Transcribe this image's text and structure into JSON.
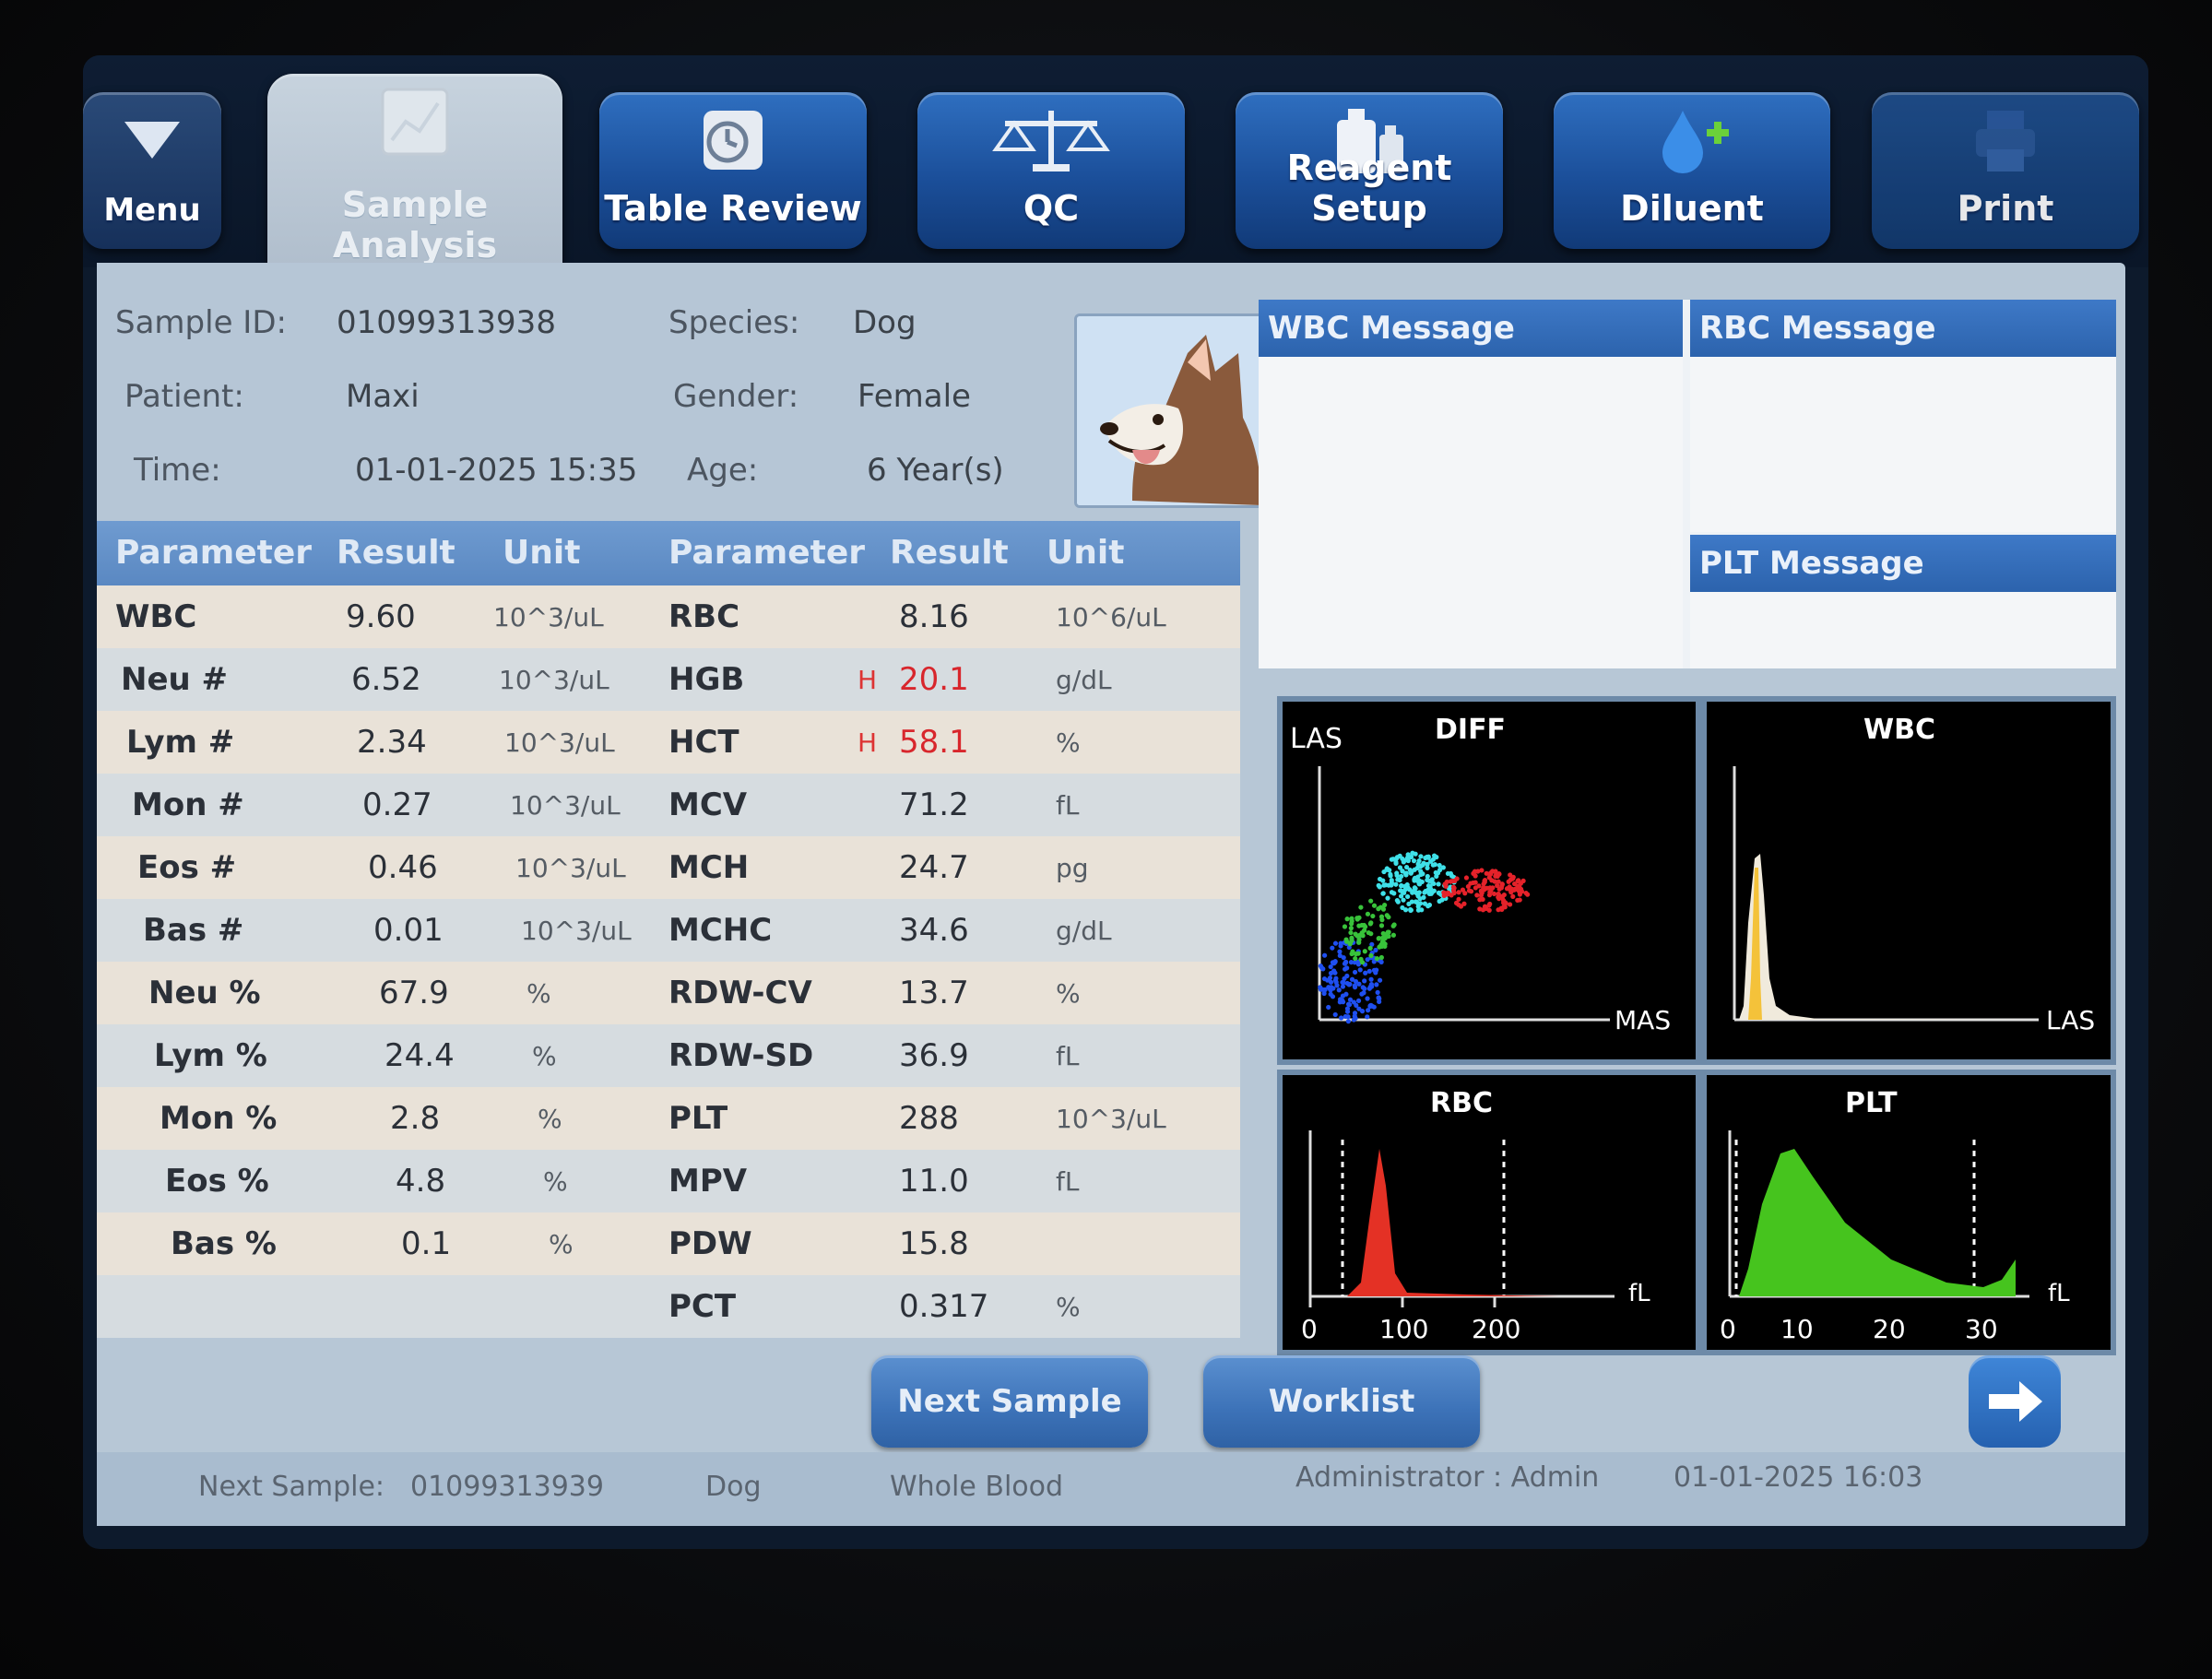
{
  "toolbar": {
    "menu": "Menu",
    "sample_analysis": "Sample Analysis",
    "table_review": "Table Review",
    "qc": "QC",
    "reagent_setup": "Reagent Setup",
    "diluent": "Diluent",
    "print": "Print"
  },
  "sample_info": {
    "sample_id_label": "Sample ID:",
    "sample_id": "01099313938",
    "patient_label": "Patient:",
    "patient": "Maxi",
    "time_label": "Time:",
    "time": "01-01-2025 15:35",
    "species_label": "Species:",
    "species": "Dog",
    "gender_label": "Gender:",
    "gender": "Female",
    "age_label": "Age:",
    "age": "6 Year(s)"
  },
  "table": {
    "headers": [
      "Parameter",
      "Result",
      "Unit",
      "Parameter",
      "Result",
      "Unit"
    ],
    "rows": [
      {
        "p1": "WBC",
        "r1": "9.60",
        "u1": "10^3/uL",
        "p2": "RBC",
        "f2": "",
        "r2": "8.16",
        "u2": "10^6/uL"
      },
      {
        "p1": "Neu #",
        "r1": "6.52",
        "u1": "10^3/uL",
        "p2": "HGB",
        "f2": "H",
        "r2": "20.1",
        "u2": "g/dL"
      },
      {
        "p1": "Lym #",
        "r1": "2.34",
        "u1": "10^3/uL",
        "p2": "HCT",
        "f2": "H",
        "r2": "58.1",
        "u2": "%"
      },
      {
        "p1": "Mon #",
        "r1": "0.27",
        "u1": "10^3/uL",
        "p2": "MCV",
        "f2": "",
        "r2": "71.2",
        "u2": "fL"
      },
      {
        "p1": "Eos #",
        "r1": "0.46",
        "u1": "10^3/uL",
        "p2": "MCH",
        "f2": "",
        "r2": "24.7",
        "u2": "pg"
      },
      {
        "p1": "Bas #",
        "r1": "0.01",
        "u1": "10^3/uL",
        "p2": "MCHC",
        "f2": "",
        "r2": "34.6",
        "u2": "g/dL"
      },
      {
        "p1": "Neu %",
        "r1": "67.9",
        "u1": "%",
        "p2": "RDW-CV",
        "f2": "",
        "r2": "13.7",
        "u2": "%"
      },
      {
        "p1": "Lym %",
        "r1": "24.4",
        "u1": "%",
        "p2": "RDW-SD",
        "f2": "",
        "r2": "36.9",
        "u2": "fL"
      },
      {
        "p1": "Mon %",
        "r1": "2.8",
        "u1": "%",
        "p2": "PLT",
        "f2": "",
        "r2": "288",
        "u2": "10^3/uL"
      },
      {
        "p1": "Eos %",
        "r1": "4.8",
        "u1": "%",
        "p2": "MPV",
        "f2": "",
        "r2": "11.0",
        "u2": "fL"
      },
      {
        "p1": "Bas %",
        "r1": "0.1",
        "u1": "%",
        "p2": "PDW",
        "f2": "",
        "r2": "15.8",
        "u2": ""
      },
      {
        "p1": "",
        "r1": "",
        "u1": "",
        "p2": "PCT",
        "f2": "",
        "r2": "0.317",
        "u2": "%"
      }
    ]
  },
  "messages": {
    "wbc": "WBC Message",
    "rbc": "RBC Message",
    "plt": "PLT Message"
  },
  "graphs": {
    "diff": {
      "title": "DIFF",
      "y_label": "LAS",
      "x_label": "MAS"
    },
    "wbc": {
      "title": "WBC",
      "x_label": "LAS"
    },
    "rbc": {
      "title": "RBC",
      "unit": "fL",
      "ticks": [
        "0",
        "100",
        "200"
      ]
    },
    "plt": {
      "title": "PLT",
      "unit": "fL",
      "ticks": [
        "0",
        "10",
        "20",
        "30"
      ]
    }
  },
  "buttons": {
    "next_sample": "Next Sample",
    "worklist": "Worklist"
  },
  "status": {
    "next_sample_label": "Next Sample:",
    "next_sample_id": "01099313939",
    "species": "Dog",
    "sample_type": "Whole Blood",
    "user": "Administrator : Admin",
    "datetime": "01-01-2025 16:03"
  },
  "colors": {
    "flag_high": "#d8262c",
    "header_blue": "#5a88c2",
    "button_blue": "#2c63ad"
  }
}
